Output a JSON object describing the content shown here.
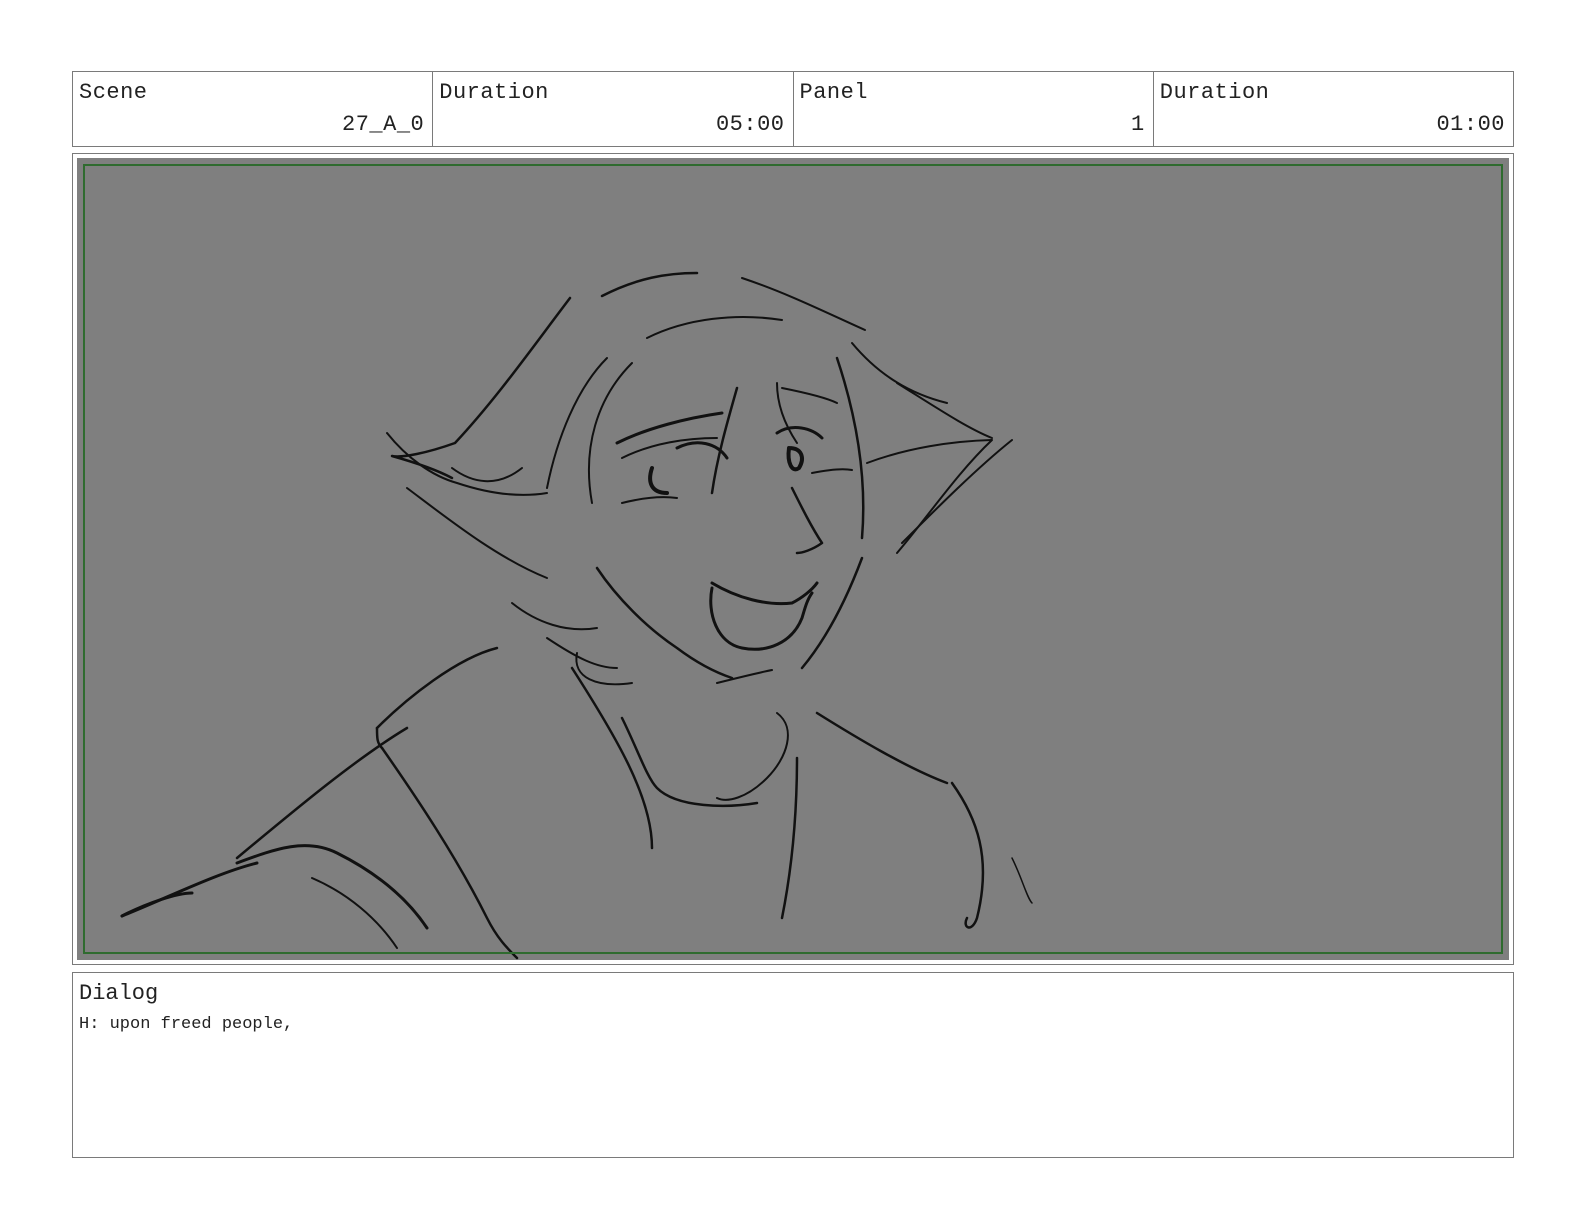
{
  "header": {
    "scene": {
      "label": "Scene",
      "value": "27_A_0"
    },
    "scene_duration": {
      "label": "Duration",
      "value": "05:00"
    },
    "panel": {
      "label": "Panel",
      "value": "1"
    },
    "panel_duration": {
      "label": "Duration",
      "value": "01:00"
    }
  },
  "panel_image": {
    "background_color": "#7f7f7f",
    "safe_area_color": "#2f6b2f"
  },
  "dialog": {
    "title": "Dialog",
    "text": "H: upon freed people,"
  }
}
